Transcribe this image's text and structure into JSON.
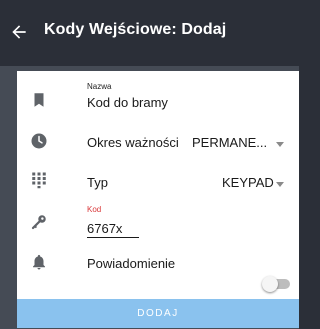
{
  "header": {
    "title": "Kody Wejściowe: Dodaj",
    "back_icon": "arrow-back-icon"
  },
  "form": {
    "name": {
      "icon": "bookmark-icon",
      "label": "Nazwa",
      "value": "Kod do bramy"
    },
    "validity": {
      "icon": "clock-icon",
      "label": "Okres ważności",
      "selected": "PERMANE..."
    },
    "type": {
      "icon": "keypad-icon",
      "label": "Typ",
      "selected": "KEYPAD"
    },
    "code": {
      "icon": "key-icon",
      "label": "Kod",
      "value": "6767x",
      "label_color": "#d9383a"
    },
    "notification": {
      "icon": "bell-icon",
      "label": "Powiadomienie",
      "enabled": false
    },
    "submit_label": "DODAJ"
  },
  "colors": {
    "appbar": "#2b2f38",
    "button": "#8ac2ee",
    "icon": "#5f6368"
  }
}
